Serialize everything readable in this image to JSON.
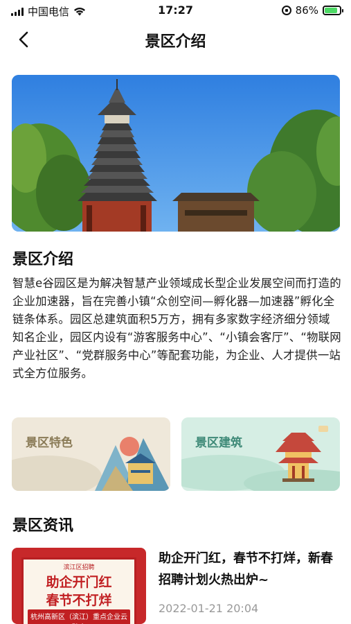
{
  "status_bar": {
    "carrier": "中国电信",
    "time": "17:27",
    "battery": "86%",
    "battery_level": 0.86
  },
  "nav": {
    "title": "景区介绍"
  },
  "intro": {
    "heading": "景区介绍",
    "text": "智慧e谷园区是为解决智慧产业领域成长型企业发展空间而打造的企业加速器，旨在完善小镇“众创空间—孵化器—加速器”孵化全链条体系。园区总建筑面积5万方，拥有多家数字经济细分领域知名企业，园区内设有“游客服务中心”、“小镇会客厅”、“物联网产业社区”、“党群服务中心”等配套功能，为企业、人才提供一站式全方位服务。"
  },
  "cards": [
    {
      "label": "景区特色",
      "color": "#8a7b57"
    },
    {
      "label": "景区建筑",
      "color": "#3f8a78"
    }
  ],
  "news": {
    "heading": "景区资讯",
    "items": [
      {
        "title": "助企开门红，春节不打烊，新春招聘计划火热出炉~",
        "date": "2022-01-21 20:04",
        "thumb": {
          "top": "滨江区招聘",
          "line1": "助企开门红",
          "line2": "春节不打烊",
          "line3": "杭州高新区（滨江）重点企业云聘会"
        }
      }
    ]
  }
}
